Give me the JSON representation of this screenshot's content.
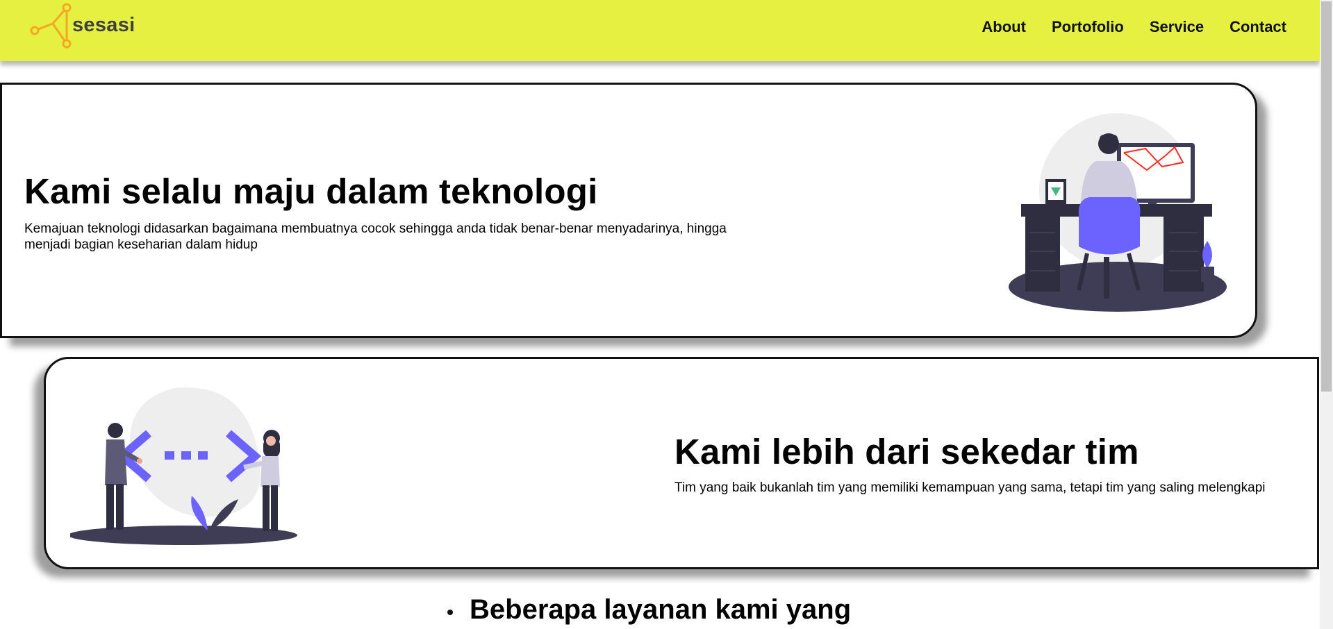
{
  "header": {
    "logo_text": "sesasi",
    "nav": [
      "About",
      "Portofolio",
      "Service",
      "Contact"
    ]
  },
  "hero1": {
    "title": "Kami selalu maju dalam teknologi",
    "description": "Kemajuan teknologi didasarkan bagaimana membuatnya cocok sehingga anda tidak benar-benar menyadarinya, hingga menjadi bagian keseharian dalam hidup"
  },
  "hero2": {
    "title": "Kami lebih dari sekedar tim",
    "description": "Tim yang baik bukanlah tim yang memiliki kemampuan yang sama, tetapi tim yang saling melengkapi"
  },
  "services": {
    "heading": "Beberapa layanan kami yang"
  },
  "colors": {
    "navbar": "#e5f041",
    "logo_accent": "#f5a623",
    "illustration_primary": "#6c63ff",
    "illustration_dark": "#3f3d56",
    "laravel_red": "#ff2d20",
    "vue_green": "#41b883"
  },
  "icons": {
    "logo": "network-nodes-icon"
  }
}
